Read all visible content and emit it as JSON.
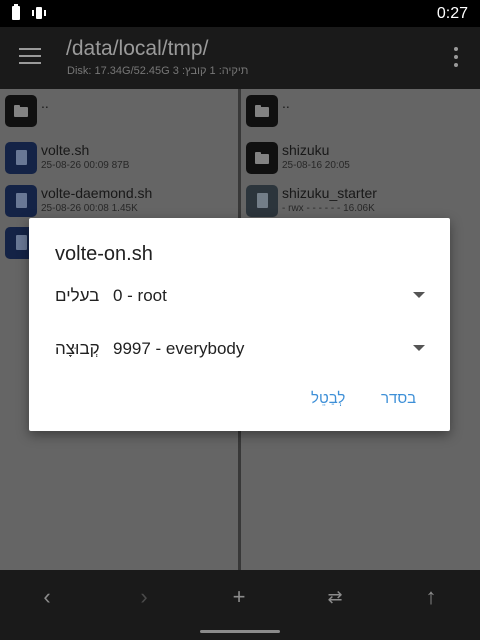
{
  "status_bar": {
    "time": "0:27"
  },
  "app_bar": {
    "path": "/data/local/tmp/",
    "info": "Disk: 17.34G/52.45G  3 :תיקיה: 1 קובץ"
  },
  "left_pane": {
    "items": [
      {
        "name": "..",
        "meta": "",
        "type": "folder"
      },
      {
        "name": "volte.sh",
        "meta": "25-08-26 00:09  87B",
        "type": "script"
      },
      {
        "name": "volte-daemond.sh",
        "meta": "25-08-26 00:08  1.45K",
        "type": "script"
      },
      {
        "name": "",
        "meta": "",
        "type": "script"
      }
    ]
  },
  "right_pane": {
    "items": [
      {
        "name": "..",
        "meta": "",
        "type": "folder"
      },
      {
        "name": "shizuku",
        "meta": "25-08-16 20:05",
        "type": "folder"
      },
      {
        "name": "shizuku_starter",
        "meta": "- rwx - - - - - -    16.06K",
        "type": "file"
      }
    ]
  },
  "dialog": {
    "title": "volte-on.sh",
    "owner_label": "בעלים",
    "owner_value": "0 - root",
    "group_label": "קְבוּצָה",
    "group_value": "9997 - everybody",
    "cancel_label": "לְבַטֵל",
    "ok_label": "בסדר",
    "accent_color": "#3d8fd7"
  },
  "bottom_bar": {
    "icons": [
      "chevron-left-icon",
      "chevron-right-icon",
      "plus-icon",
      "swap-icon",
      "arrow-up-icon"
    ]
  }
}
